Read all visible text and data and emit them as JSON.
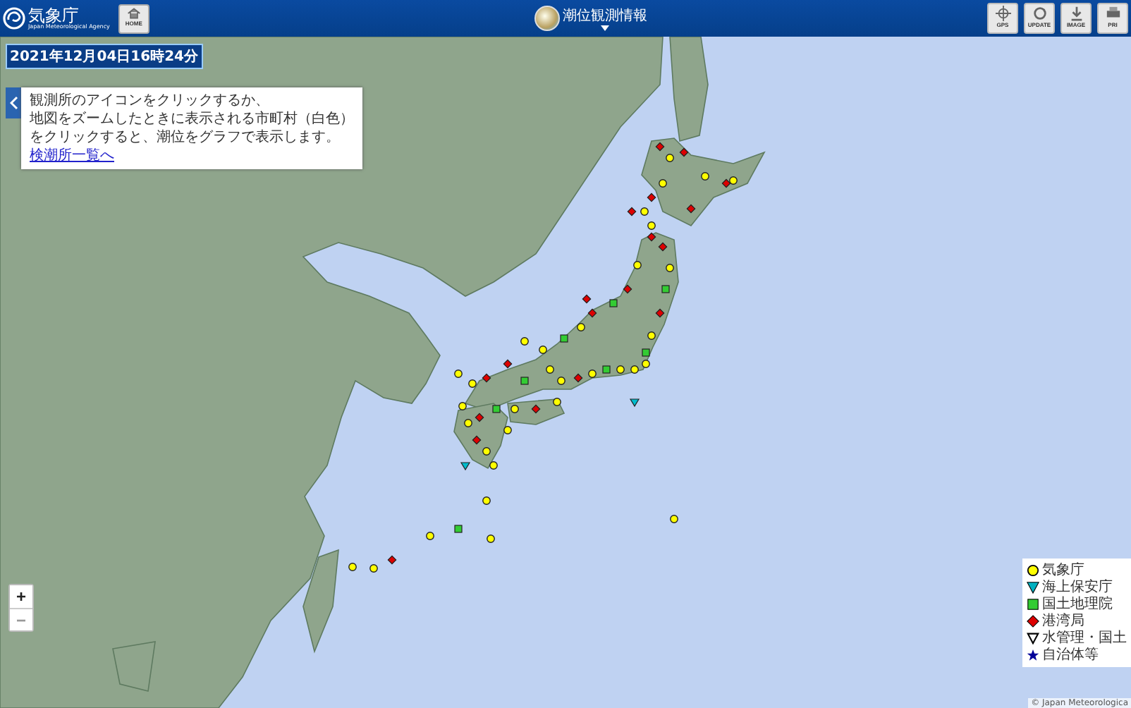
{
  "header": {
    "logo": {
      "name": "気象庁",
      "subtitle": "Japan Meteorological Agency"
    },
    "home_button": "HOME",
    "title": "潮位観測情報",
    "tools": [
      {
        "label": "GPS",
        "kind": "gps"
      },
      {
        "label": "UPDATE",
        "kind": "update"
      },
      {
        "label": "IMAGE",
        "kind": "image"
      },
      {
        "label": "PRI",
        "kind": "print"
      }
    ]
  },
  "timestamp": "2021年12月04日16時24分",
  "info_panel": {
    "lines": [
      "観測所のアイコンをクリックするか、",
      "地図をズームしたときに表示される市町村（白色）",
      "をクリックすると、潮位をグラフで表示します。"
    ],
    "link": "検潮所一覧へ"
  },
  "legend": {
    "items": [
      {
        "label": "気象庁",
        "kind": "circle",
        "color": "#ffff00"
      },
      {
        "label": "海上保安庁",
        "kind": "triangle",
        "color": "#00b0c0"
      },
      {
        "label": "国土地理院",
        "kind": "square",
        "color": "#33cc33"
      },
      {
        "label": "港湾局",
        "kind": "diamond",
        "color": "#dd0000"
      },
      {
        "label": "水管理・国土",
        "kind": "triangle-outline"
      },
      {
        "label": "自治体等",
        "kind": "star",
        "color": "#000099"
      }
    ]
  },
  "zoom": {
    "in": "+",
    "out": "−"
  },
  "attribution": "© Japan Meteorologica"
}
